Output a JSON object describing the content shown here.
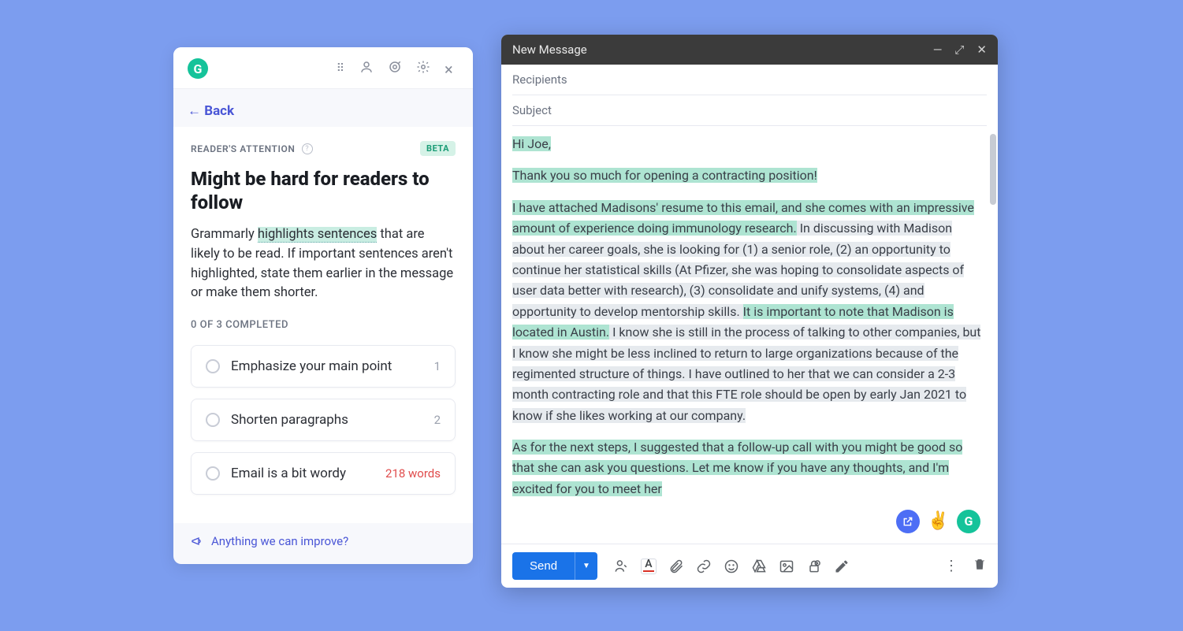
{
  "grammarly": {
    "back_label": "← Back",
    "section_label": "READER'S ATTENTION",
    "beta": "BETA",
    "title": "Might be hard for readers to follow",
    "desc_pre": "Grammarly ",
    "desc_hl": "highlights sentences",
    "desc_post": " that are likely to be read. If important sentences aren't highlighted, state them earlier in the message or make them shorter.",
    "progress": "0 OF 3 COMPLETED",
    "suggestions": [
      {
        "label": "Emphasize your main point",
        "count": "1",
        "red": false
      },
      {
        "label": "Shorten paragraphs",
        "count": "2",
        "red": false
      },
      {
        "label": "Email is a bit wordy",
        "count": "218 words",
        "red": true
      }
    ],
    "feedback": "Anything we can improve?"
  },
  "compose": {
    "title": "New Message",
    "recipients_placeholder": "Recipients",
    "subject_placeholder": "Subject",
    "body": {
      "p1_hl": "Hi Joe,",
      "p2_hl": "Thank you so much for opening a contracting position!",
      "p3_a": "I have attached Madisons' resume to this email, and she comes with an impressive amount of experience doing immunology research.",
      "p3_b": " In discussing with Madison about her career goals, she is looking for (1) a senior role, (2) an opportunity to continue her statistical skills (At Pfizer, she was hoping to consolidate aspects of user data better with research), (3) consolidate and unify systems, (4) and opportunity to develop mentorship skills. ",
      "p3_c_hl": "It is important to note that Madison is located in Austin.",
      "p3_d": " I know she is still in the process of talking to other companies, but I know she might be less inclined to return to large organizations because of the regimented structure of things. I have outlined to her that we can consider a 2-3 month contracting role and that this FTE role should be open by early Jan 2021 to know if she likes working at our company.",
      "p4": "As for the next steps, I suggested that a follow-up call with you might be good so that she can ask you questions. Let me know if you have any thoughts, and I'm excited for you to meet her"
    },
    "float": {
      "emoji": "✌️"
    },
    "send_label": "Send"
  }
}
